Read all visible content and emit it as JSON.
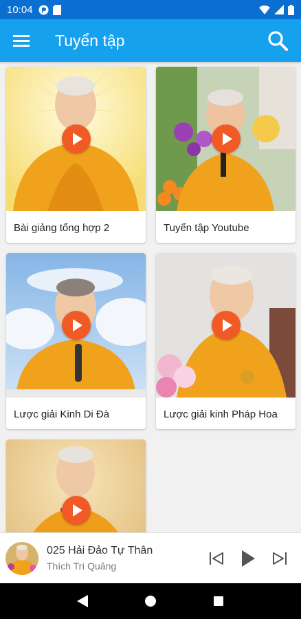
{
  "status_bar": {
    "time": "10:04"
  },
  "app_bar": {
    "title": "Tuyển tập"
  },
  "cards": [
    {
      "title": "Bài giảng tổng hợp 2"
    },
    {
      "title": "Tuyển tập Youtube"
    },
    {
      "title": "Lược giải Kinh Di Đà"
    },
    {
      "title": "Lược giải kinh Pháp Hoa"
    },
    {
      "title": ""
    }
  ],
  "player": {
    "title": "025 Hải Đảo Tự Thân",
    "artist": "Thích Trí Quảng"
  },
  "colors": {
    "status_bar": "#0a6fd1",
    "app_bar": "#16a1ee",
    "play_button": "#f15a24",
    "robe": "#f0a21d"
  },
  "icons": {
    "menu": "menu-icon",
    "search": "search-icon",
    "play": "play-icon",
    "prev": "skip-previous-icon",
    "next": "skip-next-icon",
    "back": "back-icon",
    "home": "home-icon",
    "recents": "recents-icon"
  }
}
